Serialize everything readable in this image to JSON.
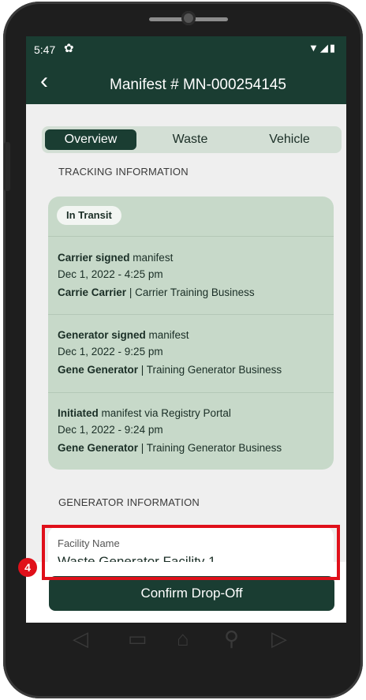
{
  "status_bar": {
    "time": "5:47",
    "gear": "✿",
    "indicators": "▼◢▮"
  },
  "header": {
    "back": "‹",
    "title": "Manifest # MN-000254145"
  },
  "tabs": [
    {
      "label": "Overview",
      "active": true
    },
    {
      "label": "Waste",
      "active": false
    },
    {
      "label": "Vehicle",
      "active": false
    }
  ],
  "tracking": {
    "section_title": "TRACKING INFORMATION",
    "status": "In Transit",
    "events": [
      {
        "actor_action": "Carrier signed",
        "rest": " manifest",
        "date": "Dec 1, 2022 - 4:25 pm",
        "person": "Carrie Carrier",
        "org": " | Carrier Training Business"
      },
      {
        "actor_action": "Generator signed",
        "rest": " manifest",
        "date": "Dec 1, 2022 - 9:25 pm",
        "person": "Gene Generator",
        "org": " | Training Generator Business"
      },
      {
        "actor_action": "Initiated",
        "rest": " manifest via Registry Portal",
        "date": "Dec 1, 2022 - 9:24 pm",
        "person": "Gene Generator",
        "org": " | Training Generator Business"
      }
    ]
  },
  "generator": {
    "section_title": "GENERATOR INFORMATION",
    "facility_label": "Facility Name",
    "facility_value": "Waste Generator Facility 1"
  },
  "actions": {
    "confirm_label": "Confirm Drop-Off"
  },
  "annotation": {
    "step": "4",
    "color": "#e0101a"
  },
  "nav_bar": {
    "back": "◁",
    "recents": "▭",
    "home": "⌂",
    "search": "⚲",
    "forward": "▷"
  },
  "colors": {
    "primary": "#1a3d32",
    "card": "#c7d9c9",
    "tab_bg": "#d3dfd5"
  }
}
